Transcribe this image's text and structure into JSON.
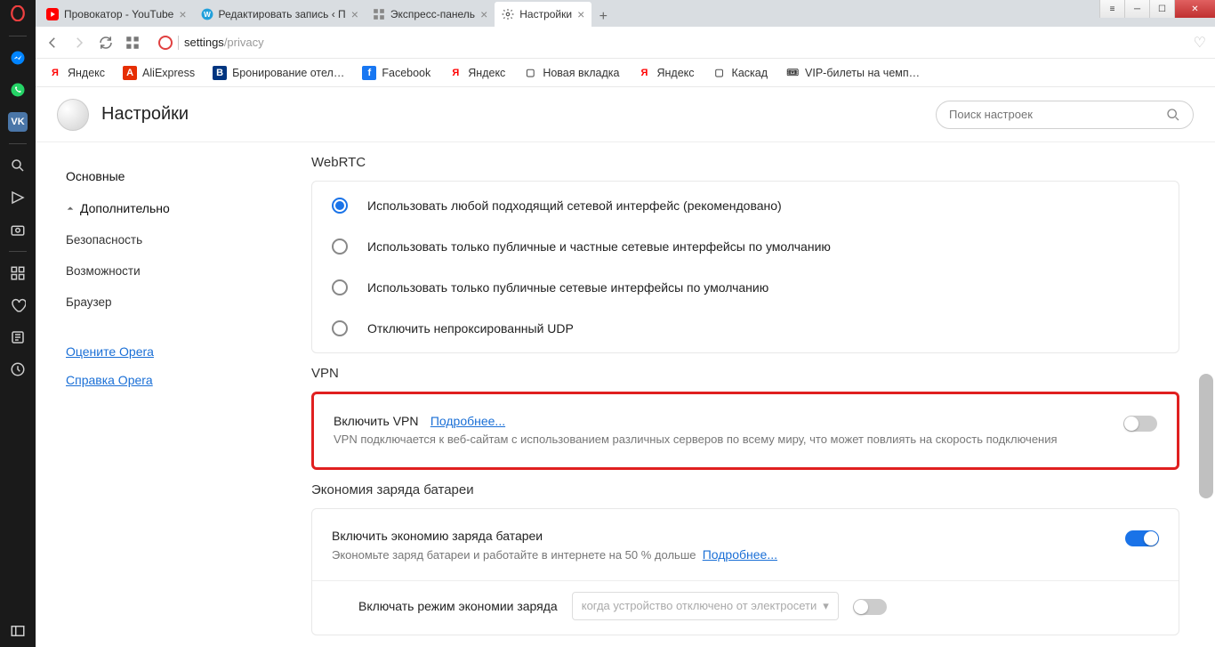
{
  "tabs": [
    {
      "title": "Провокатор - YouTube"
    },
    {
      "title": "Редактировать запись ‹ П"
    },
    {
      "title": "Экспресс-панель"
    },
    {
      "title": "Настройки"
    }
  ],
  "address": {
    "main": "settings",
    "sub": "/privacy"
  },
  "bookmarks": [
    "Яндекс",
    "AliExpress",
    "Бронирование отел…",
    "Facebook",
    "Яндекс",
    "Новая вкладка",
    "Яндекс",
    "Каскад",
    "VIP-билеты на чемп…"
  ],
  "settings": {
    "title": "Настройки",
    "search_placeholder": "Поиск настроек",
    "nav": {
      "basic": "Основные",
      "advanced": "Дополнительно",
      "security": "Безопасность",
      "features": "Возможности",
      "browser": "Браузер",
      "rate": "Оцените Opera",
      "help": "Справка Opera"
    },
    "webrtc": {
      "title": "WebRTC",
      "opt1": "Использовать любой подходящий сетевой интерфейс (рекомендовано)",
      "opt2": "Использовать только публичные и частные сетевые интерфейсы по умолчанию",
      "opt3": "Использовать только публичные сетевые интерфейсы по умолчанию",
      "opt4": "Отключить непроксированный UDP"
    },
    "vpn": {
      "title": "VPN",
      "label": "Включить VPN",
      "link": "Подробнее...",
      "desc": "VPN подключается к веб-сайтам с использованием различных серверов по всему миру, что может повлиять на скорость подключения"
    },
    "battery": {
      "title": "Экономия заряда батареи",
      "label": "Включить экономию заряда батареи",
      "desc": "Экономьте заряд батареи и работайте в интернете на 50 % дольше",
      "link": "Подробнее...",
      "sub_label": "Включать режим экономии заряда",
      "dropdown": "когда устройство отключено от электросети"
    }
  }
}
